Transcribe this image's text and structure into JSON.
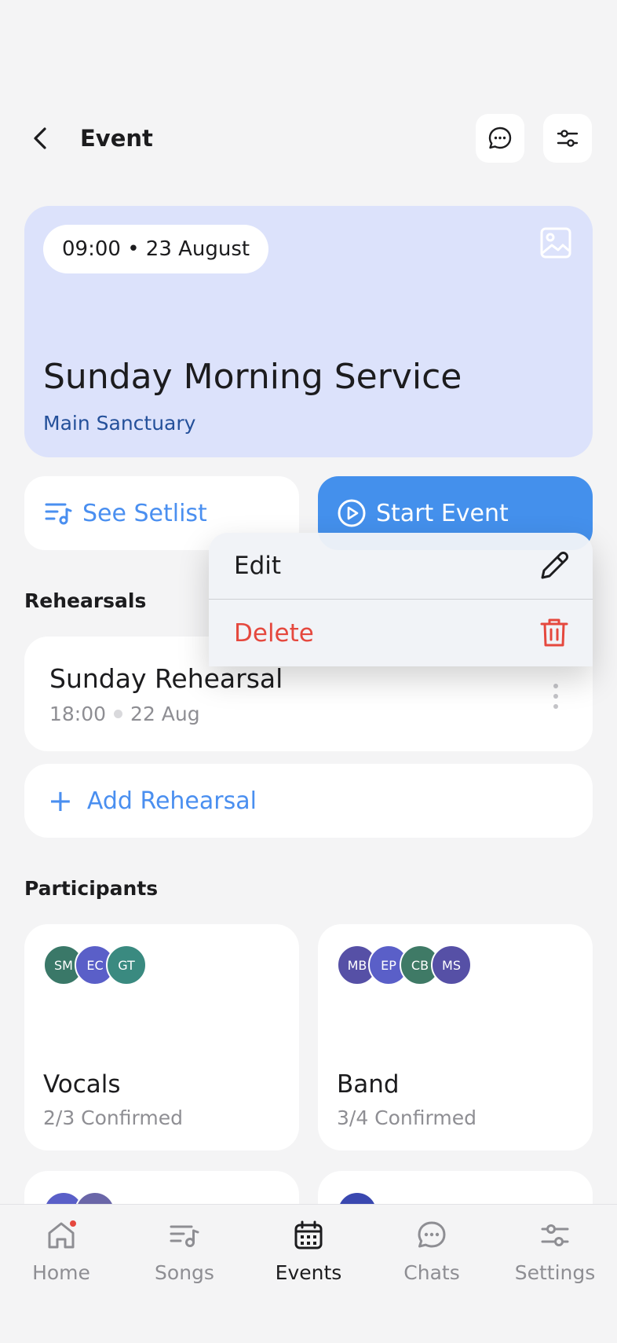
{
  "header": {
    "title": "Event",
    "back_icon": "chevron-left-icon",
    "chat_icon": "chat-bubble-icon",
    "filter_icon": "sliders-icon"
  },
  "event": {
    "datetime": "09:00 • 23 August",
    "title": "Sunday Morning Service",
    "location": "Main Sanctuary",
    "image_icon": "image-placeholder-icon",
    "colors": {
      "hero_bg": "#dce2fb",
      "location": "#24509a"
    }
  },
  "actions": {
    "setlist_label": "See Setlist",
    "start_label": "Start Event",
    "colors": {
      "accent": "#4490ec"
    }
  },
  "context_menu": {
    "edit_label": "Edit",
    "delete_label": "Delete",
    "colors": {
      "delete": "#e5483e"
    }
  },
  "rehearsals": {
    "section_label": "Rehearsals",
    "items": [
      {
        "title": "Sunday Rehearsal",
        "time": "18:00",
        "date": "22 Aug"
      }
    ],
    "add_label": "Add Rehearsal"
  },
  "participants": {
    "section_label": "Participants",
    "groups": [
      {
        "name": "Vocals",
        "confirmed": "2/3 Confirmed",
        "avatars": [
          {
            "initials": "SM",
            "color": "#3a7868"
          },
          {
            "initials": "EC",
            "color": "#5a5fc8"
          },
          {
            "initials": "GT",
            "color": "#3a8a80"
          }
        ]
      },
      {
        "name": "Band",
        "confirmed": "3/4 Confirmed",
        "avatars": [
          {
            "initials": "MB",
            "color": "#5650a6"
          },
          {
            "initials": "EP",
            "color": "#5a5fc8"
          },
          {
            "initials": "CB",
            "color": "#3f7a66"
          },
          {
            "initials": "MS",
            "color": "#5650a6"
          }
        ]
      }
    ]
  },
  "tabbar": {
    "tabs": [
      {
        "label": "Home",
        "icon": "home-icon",
        "active": false,
        "badge": true
      },
      {
        "label": "Songs",
        "icon": "music-list-icon",
        "active": false
      },
      {
        "label": "Events",
        "icon": "calendar-icon",
        "active": true
      },
      {
        "label": "Chats",
        "icon": "chat-bubble-icon",
        "active": false
      },
      {
        "label": "Settings",
        "icon": "sliders-icon",
        "active": false
      }
    ],
    "colors": {
      "badge": "#e5483e"
    }
  }
}
